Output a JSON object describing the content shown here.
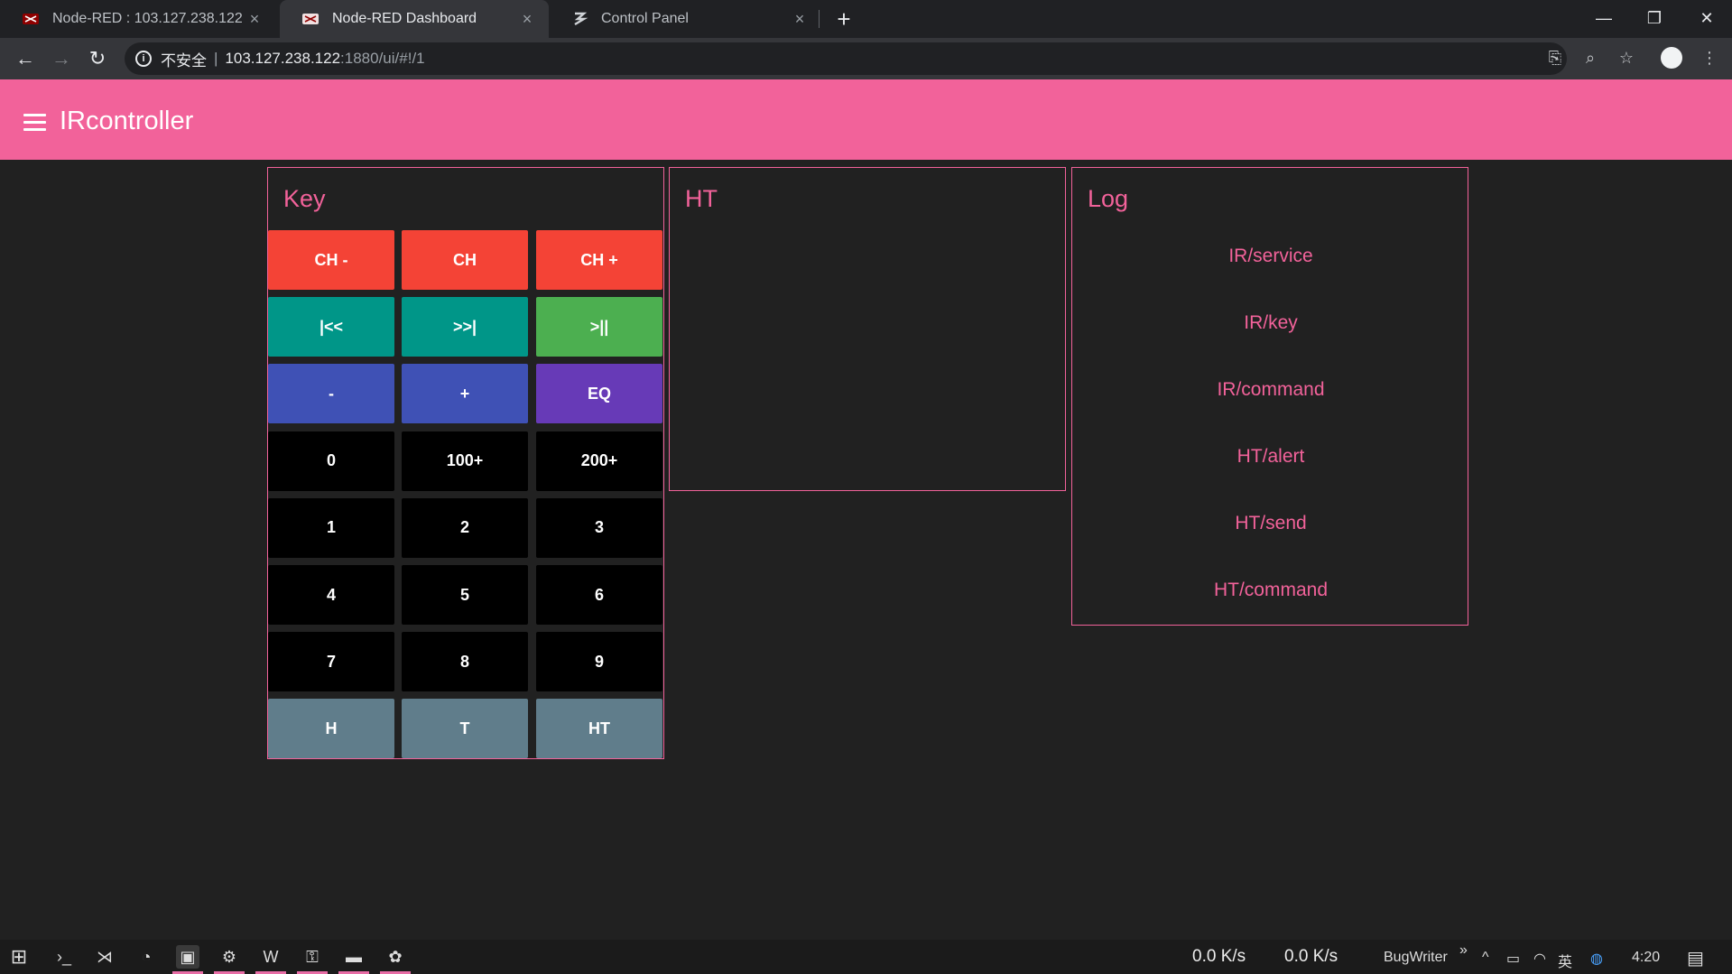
{
  "browser": {
    "tabs": [
      {
        "title": "Node-RED : 103.127.238.122",
        "icon": "node-red-icon"
      },
      {
        "title": "Node-RED Dashboard",
        "icon": "node-red-icon"
      },
      {
        "title": "Control Panel",
        "icon": "control-panel-icon"
      }
    ],
    "close_glyph": "×",
    "newtab_glyph": "+",
    "window_controls": {
      "minimize": "—",
      "restore": "❐",
      "close": "✕"
    },
    "nav": {
      "back": "←",
      "forward": "→",
      "reload": "↻"
    },
    "address": {
      "security": "不安全",
      "separator": "|",
      "host": "103.127.238.122",
      "path": ":1880/ui/#!/1"
    },
    "toolbar_icons": {
      "translate": "⎘",
      "zoom": "⌕",
      "bookmark": "☆",
      "menu": "⋮"
    }
  },
  "app": {
    "title": "IRcontroller",
    "colors": {
      "accent": "#f2629a",
      "background": "#212121"
    }
  },
  "key_group": {
    "title": "Key",
    "rows": [
      [
        {
          "label": "CH -",
          "color": "#f44336"
        },
        {
          "label": "CH",
          "color": "#f44336"
        },
        {
          "label": "CH +",
          "color": "#f44336"
        }
      ],
      [
        {
          "label": "|<<",
          "color": "#009688"
        },
        {
          "label": ">>|",
          "color": "#009688"
        },
        {
          "label": ">||",
          "color": "#4caf50"
        }
      ],
      [
        {
          "label": "-",
          "color": "#3f51b5"
        },
        {
          "label": "+",
          "color": "#3f51b5"
        },
        {
          "label": "EQ",
          "color": "#673ab7"
        }
      ],
      [
        {
          "label": "0",
          "color": "#000000"
        },
        {
          "label": "100+",
          "color": "#000000"
        },
        {
          "label": "200+",
          "color": "#000000"
        }
      ],
      [
        {
          "label": "1",
          "color": "#000000"
        },
        {
          "label": "2",
          "color": "#000000"
        },
        {
          "label": "3",
          "color": "#000000"
        }
      ],
      [
        {
          "label": "4",
          "color": "#000000"
        },
        {
          "label": "5",
          "color": "#000000"
        },
        {
          "label": "6",
          "color": "#000000"
        }
      ],
      [
        {
          "label": "7",
          "color": "#000000"
        },
        {
          "label": "8",
          "color": "#000000"
        },
        {
          "label": "9",
          "color": "#000000"
        }
      ],
      [
        {
          "label": "H",
          "color": "#607d8b"
        },
        {
          "label": "T",
          "color": "#607d8b"
        },
        {
          "label": "HT",
          "color": "#607d8b"
        }
      ]
    ]
  },
  "ht_group": {
    "title": "HT"
  },
  "log_group": {
    "title": "Log",
    "items": [
      "IR/service",
      "IR/key",
      "IR/command",
      "HT/alert",
      "HT/send",
      "HT/command"
    ]
  },
  "taskbar": {
    "start_glyph": "⊞",
    "apps": [
      {
        "icon": "powershell-icon",
        "glyph": "›_"
      },
      {
        "icon": "vscode-icon",
        "glyph": "⋊"
      },
      {
        "icon": "clock-app-icon",
        "glyph": "◔"
      },
      {
        "icon": "window-app-icon",
        "glyph": "▣"
      },
      {
        "icon": "settings-icon",
        "glyph": "⚙"
      },
      {
        "icon": "word-icon",
        "glyph": "W"
      },
      {
        "icon": "network-app-icon",
        "glyph": "⚿"
      },
      {
        "icon": "folder-icon",
        "glyph": "▬"
      },
      {
        "icon": "photos-app-icon",
        "glyph": "✿"
      }
    ],
    "upload_speed": "0.0 K/s",
    "download_speed": "0.0 K/s",
    "toolbar_label": "BugWriter",
    "overflow": "»",
    "tray": {
      "chevron": "^",
      "battery": "▭",
      "wifi": "◠",
      "ime": "英",
      "app": "◍"
    },
    "time": "4:20",
    "notification": "▤"
  }
}
